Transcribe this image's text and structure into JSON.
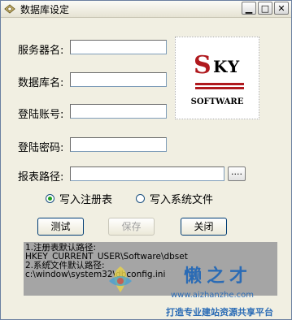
{
  "window": {
    "title": "数据库设定",
    "min_label": "▁",
    "max_label": "□",
    "close_label": "✕"
  },
  "form": {
    "server_label": "服务器名:",
    "server_value": "",
    "db_label": "数据库名:",
    "db_value": "",
    "account_label": "登陆账号:",
    "account_value": "",
    "password_label": "登陆密码:",
    "password_value": "",
    "report_path_label": "报表路径:",
    "report_path_value": "",
    "browse_label": "...."
  },
  "logo": {
    "letter_s": "S",
    "letters_ky": "KY",
    "caption": "SOFTWARE",
    "accent_color": "#b0191e"
  },
  "radios": {
    "registry_label": "写入注册表",
    "registry_checked": true,
    "sysfile_label": "写入系统文件",
    "sysfile_checked": false
  },
  "buttons": {
    "test_label": "测试",
    "save_label": "保存",
    "close_label": "关闭"
  },
  "info": {
    "line1": "1.注册表默认路径:",
    "line2": "HKEY_CURRENT_USER\\Software\\dbset",
    "line3": "2.系统文件默认路径:",
    "line4": "c:\\window\\system32\\dbconfig.ini"
  },
  "watermark": {
    "name": "懒之才",
    "url": "www.aizhanzhe.com",
    "slogan": "打造专业建站资源共享平台"
  }
}
